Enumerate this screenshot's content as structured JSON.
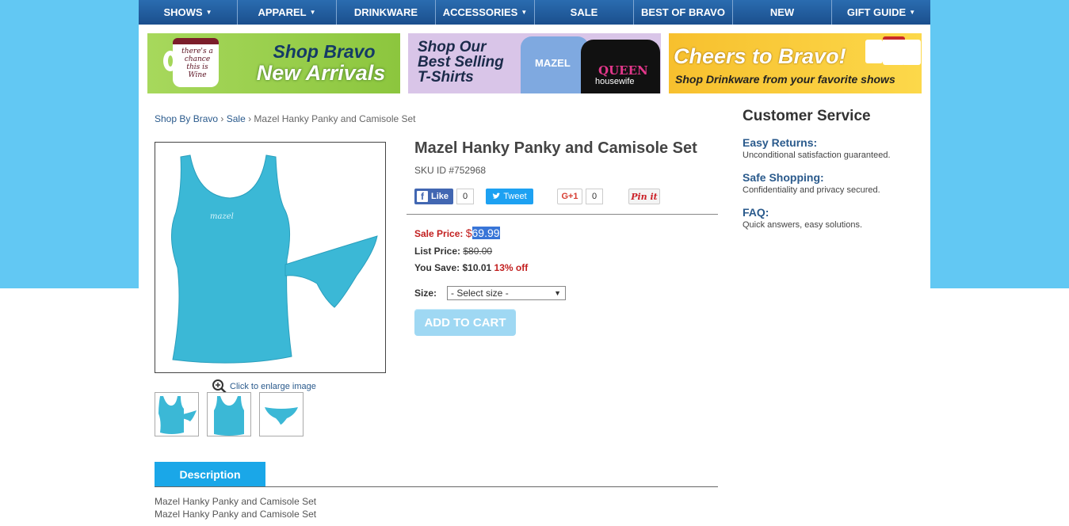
{
  "nav": {
    "items": [
      {
        "label": "SHOWS",
        "caret": "▼"
      },
      {
        "label": "APPAREL",
        "caret": "▼"
      },
      {
        "label": "DRINKWARE",
        "caret": ""
      },
      {
        "label": "ACCESSORIES",
        "caret": "▼"
      },
      {
        "label": "SALE",
        "caret": ""
      },
      {
        "label": "BEST OF BRAVO",
        "caret": ""
      },
      {
        "label": "NEW",
        "caret": ""
      },
      {
        "label": "GIFT GUIDE",
        "caret": "▼"
      }
    ]
  },
  "banners": {
    "b1": {
      "line1": "Shop Bravo",
      "line2": "New Arrivals",
      "mug_text": "there's a chance this is Wine"
    },
    "b2": {
      "text": "Shop Our Best Selling T-Shirts",
      "shirt1": "MAZEL",
      "shirt2_q": "QUEEN",
      "shirt2_h": "housewife"
    },
    "b3": {
      "line1": "Cheers to Bravo!",
      "line2": "Shop Drinkware from your favorite shows"
    }
  },
  "breadcrumb": {
    "home": "Shop By Bravo",
    "sep1": " › ",
    "sale": "Sale",
    "sep2": " › ",
    "current": "Mazel Hanky Panky and Camisole Set"
  },
  "product": {
    "title": "Mazel Hanky Panky and Camisole Set",
    "sku": "SKU ID #752968",
    "enlarge": "Click to enlarge image",
    "sale_label": "Sale Price: ",
    "sale_currency": "$",
    "sale_amount": "69.99",
    "list_label": "List Price: ",
    "list_amount": "$80.00",
    "save_label": "You Save: ",
    "save_amount": "$10.01 ",
    "save_pct": "13% off",
    "size_label": "Size:",
    "size_selected": "- Select size -",
    "add_to_cart": "ADD TO CART"
  },
  "social": {
    "fb_label": "Like",
    "fb_count": "0",
    "tw_label": "Tweet",
    "gp_label": "G+1",
    "gp_count": "0",
    "pin_label": "Pin it"
  },
  "sidebar": {
    "title": "Customer Service",
    "items": [
      {
        "head": "Easy Returns:",
        "desc": "Unconditional satisfaction guaranteed."
      },
      {
        "head": "Safe Shopping:",
        "desc": "Confidentiality and privacy secured."
      },
      {
        "head": "FAQ:",
        "desc": "Quick answers, easy solutions."
      }
    ]
  },
  "description": {
    "tab": "Description",
    "lines": [
      "Mazel Hanky Panky and Camisole Set",
      "Mazel Hanky Panky and Camisole Set"
    ]
  },
  "colors": {
    "nav": "#1b4f8d",
    "accent": "#1aa7e8",
    "sale": "#c21f1f",
    "background": "#62c8f3"
  }
}
